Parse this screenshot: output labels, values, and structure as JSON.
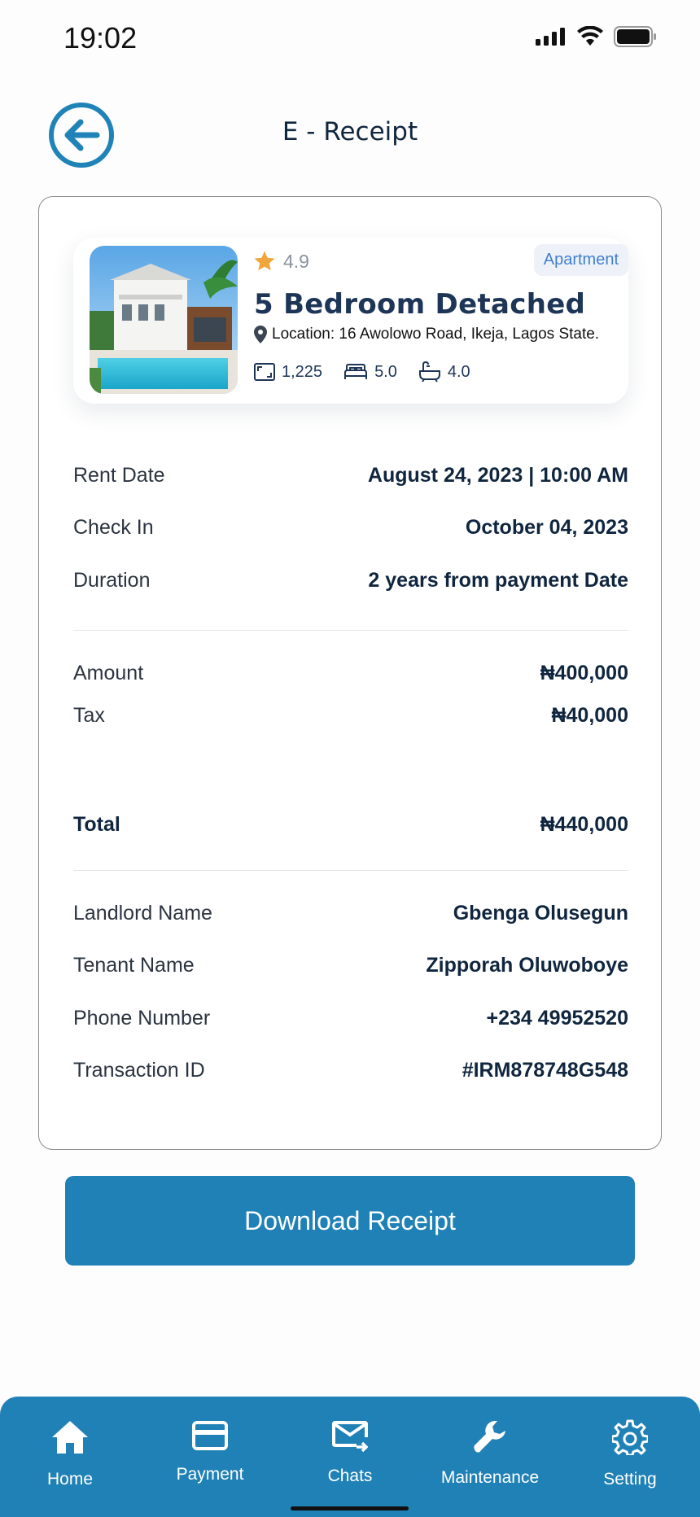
{
  "status_bar": {
    "time": "19:02"
  },
  "header": {
    "title": "E - Receipt"
  },
  "property": {
    "rating": "4.9",
    "type": "Apartment",
    "title": "5 Bedroom Detached",
    "location": "Location: 16 Awolowo Road, Ikeja, Lagos State.",
    "area": "1,225",
    "bedrooms": "5.0",
    "bathrooms": "4.0"
  },
  "booking": {
    "rent_date_label": "Rent Date",
    "rent_date_value": "August 24, 2023 | 10:00 AM",
    "check_in_label": "Check In",
    "check_in_value": "October 04, 2023",
    "duration_label": "Duration",
    "duration_value": "2 years from payment Date"
  },
  "payment": {
    "amount_label": "Amount",
    "amount_value": "₦400,000",
    "tax_label": "Tax",
    "tax_value": "₦40,000",
    "total_label": "Total",
    "total_value": "₦440,000"
  },
  "parties": {
    "landlord_label": "Landlord Name",
    "landlord_value": "Gbenga Olusegun",
    "tenant_label": "Tenant Name",
    "tenant_value": "Zipporah Oluwoboye",
    "phone_label": "Phone Number",
    "phone_value": "+234 49952520",
    "transaction_label": "Transaction ID",
    "transaction_value": "#IRM878748G548"
  },
  "actions": {
    "download_label": "Download Receipt"
  },
  "nav": {
    "home": "Home",
    "payment": "Payment",
    "chats": "Chats",
    "maintenance": "Maintenance",
    "setting": "Setting"
  },
  "colors": {
    "accent": "#2081b6",
    "star": "#f0a63a",
    "badge_text": "#3f7fd1"
  }
}
